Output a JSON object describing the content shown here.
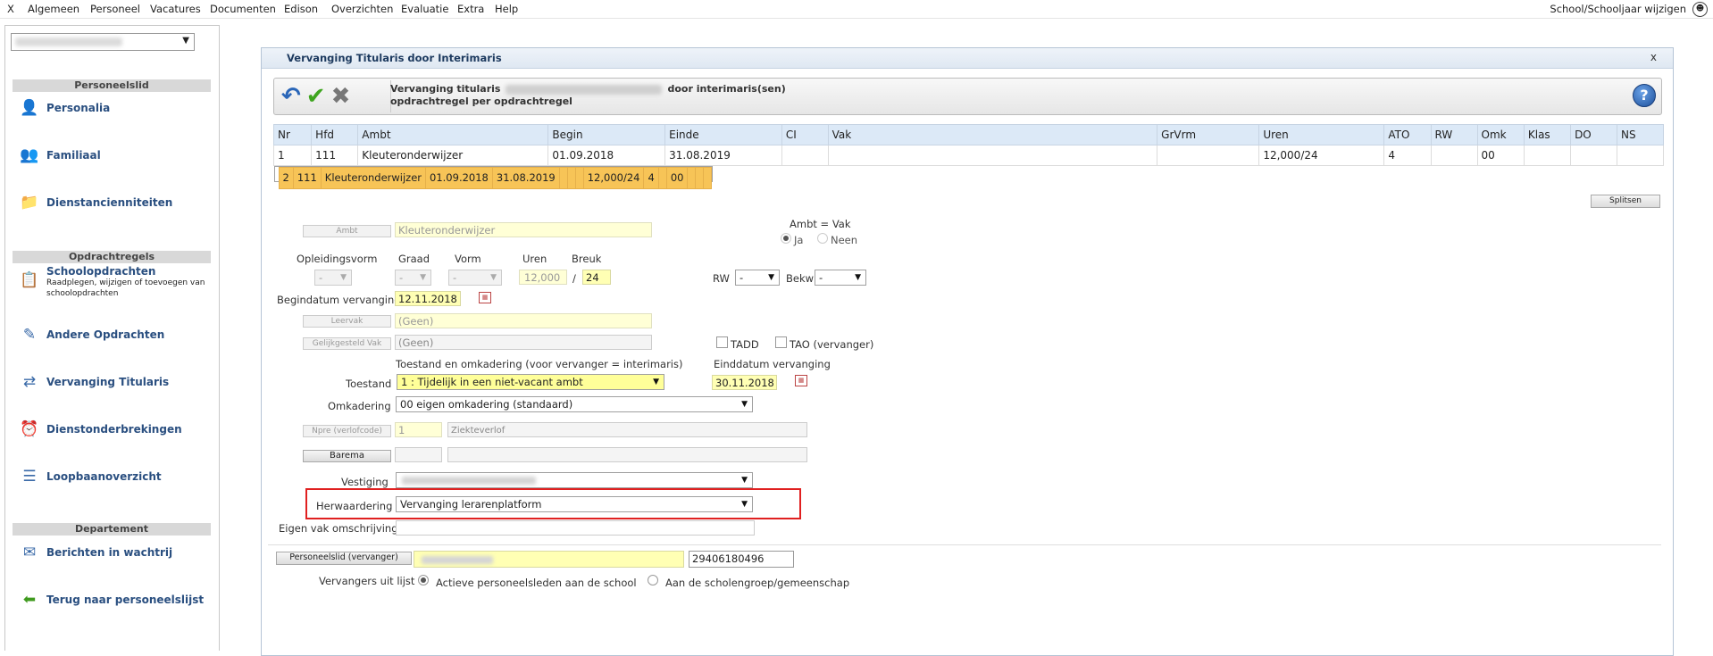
{
  "menu": {
    "items": [
      "X",
      "Algemeen",
      "Personeel",
      "Vacatures",
      "Documenten",
      "Edison",
      "Overzichten",
      "Evaluatie",
      "Extra",
      "Help"
    ],
    "right_label": "School/Schooljaar wijzigen"
  },
  "sidebar": {
    "sections": {
      "personeelslid": "Personeelslid",
      "opdrachtregels": "Opdrachtregels",
      "departement": "Departement"
    },
    "items": {
      "personalia": "Personalia",
      "familiaal": "Familiaal",
      "dienstanciënniteiten": "Dienstancienniteiten",
      "schoolopdrachten": "Schoolopdrachten",
      "schoolopdrachten_sub": "Raadplegen, wijzigen of toevoegen van schoolopdrachten",
      "andere_opdrachten": "Andere Opdrachten",
      "vervanging_titularis": "Vervanging Titularis",
      "dienstonderbrekingen": "Dienstonderbrekingen",
      "loopbaanoverzicht": "Loopbaanoverzicht",
      "berichten": "Berichten in wachtrij",
      "terug": "Terug naar personeelslijst"
    }
  },
  "dialog": {
    "title": "Vervanging Titularis door Interimaris",
    "close": "x",
    "toolbar_line1a": "Vervanging titularis",
    "toolbar_line1b": "door interimaris(sen)",
    "toolbar_line2": "opdrachtregel per opdrachtregel",
    "help": "?"
  },
  "grid": {
    "columns": [
      "Nr",
      "Hfd",
      "Ambt",
      "Begin",
      "Einde",
      "CI",
      "Vak",
      "GrVrm",
      "Uren",
      "ATO",
      "RW",
      "Omk",
      "Klas",
      "DO",
      "NS"
    ],
    "rows": [
      [
        "1",
        "111",
        "Kleuteronderwijzer",
        "01.09.2018",
        "31.08.2019",
        "",
        "",
        "",
        "12,000/24",
        "4",
        "",
        "00",
        "",
        "",
        ""
      ],
      [
        "2",
        "111",
        "Kleuteronderwijzer",
        "01.09.2018",
        "31.08.2019",
        "",
        "",
        "",
        "12,000/24",
        "4",
        "",
        "00",
        "",
        "",
        ""
      ]
    ]
  },
  "form": {
    "splitsen": "Splitsen",
    "ambt_btn": "Ambt",
    "ambt_val": "Kleuteronderwijzer",
    "ambt_vak_label": "Ambt = Vak",
    "ja": "Ja",
    "neen": "Neen",
    "opleidingsvorm": "Opleidingsvorm",
    "graad": "Graad",
    "vorm": "Vorm",
    "uren": "Uren",
    "breuk": "Breuk",
    "dash": "-",
    "uren_val": "12,000",
    "slash": "/",
    "breuk_val": "24",
    "rw": "RW",
    "bekw": "Bekw",
    "begindatum_label": "Begindatum vervanging",
    "begindatum_val": "12.11.2018",
    "leervak_btn": "Leervak",
    "leervak_val": "(Geen)",
    "gelijkgesteld_btn": "Gelijkgesteld Vak",
    "gelijkgesteld_val": "(Geen)",
    "tadd": "TADD",
    "tao": "TAO  (vervanger)",
    "toestand_hdr": "Toestand en omkadering (voor vervanger = interimaris)",
    "einddatum_label": "Einddatum vervanging",
    "toestand_label": "Toestand",
    "toestand_val": "1 : Tijdelijk in een niet-vacant ambt",
    "einddatum_val": "30.11.2018",
    "omkadering_label": "Omkadering",
    "omkadering_val": "00 eigen omkadering (standaard)",
    "npre_btn": "Npre (verlofcode)",
    "npre_val": "1",
    "npre_desc": "Ziekteverlof",
    "barema_btn": "Barema",
    "vestiging_label": "Vestiging",
    "herwaardering_label": "Herwaardering",
    "herwaardering_val": "Vervanging lerarenplatform",
    "eigen_vak_label": "Eigen vak omschrijving",
    "personeelslid_btn": "Personeelslid (vervanger)",
    "personeelslid_nr": "29406180496",
    "vervangers_label": "Vervangers uit lijst",
    "opt_actief": "Actieve personeelsleden aan de school",
    "opt_scholengroep": "Aan de scholengroep/gemeenschap"
  }
}
